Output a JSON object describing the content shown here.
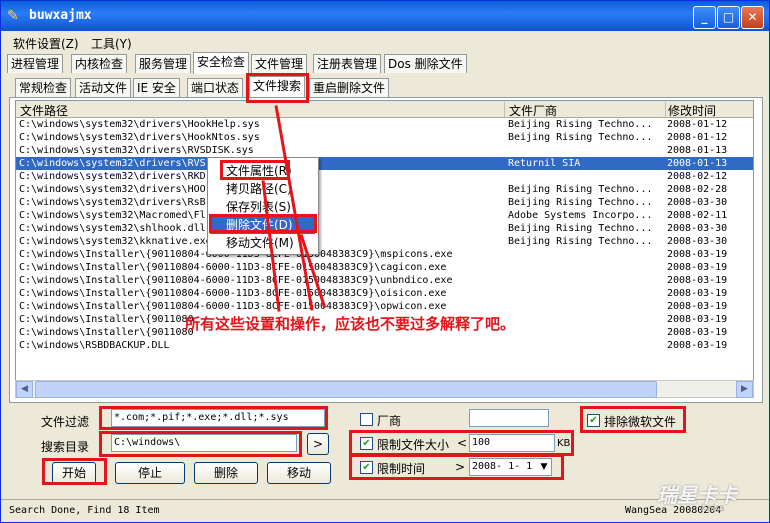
{
  "window": {
    "title": "buwxajmx",
    "min_label": "_",
    "max_label": "□",
    "close_label": "✕"
  },
  "menubar": [
    "软件设置(Z)",
    "工具(Y)"
  ],
  "main_tabs": [
    "进程管理",
    "内核检查",
    "服务管理",
    "安全检查",
    "文件管理",
    "注册表管理",
    "Dos 删除文件"
  ],
  "sub_tabs": [
    "常规检查",
    "活动文件",
    "IE 安全",
    "端口状态",
    "文件搜索",
    "重启删除文件"
  ],
  "table": {
    "headers": [
      "文件路径",
      "文件厂商",
      "修改时间"
    ],
    "rows": [
      {
        "path": "C:\\windows\\system32\\drivers\\HookHelp.sys",
        "vendor": "Beijing Rising Techno...",
        "date": "2008-01-12"
      },
      {
        "path": "C:\\windows\\system32\\drivers\\HookNtos.sys",
        "vendor": "Beijing Rising Techno...",
        "date": "2008-01-12"
      },
      {
        "path": "C:\\windows\\system32\\drivers\\RVSDISK.sys",
        "vendor": "",
        "date": "2008-01-13"
      },
      {
        "path": "C:\\windows\\system32\\drivers\\RVS",
        "vendor": "Returnil SIA",
        "date": "2008-01-13"
      },
      {
        "path": "C:\\windows\\system32\\drivers\\RKD",
        "vendor": "",
        "date": "2008-02-12"
      },
      {
        "path": "C:\\windows\\system32\\drivers\\HOO",
        "vendor": "Beijing Rising Techno...",
        "date": "2008-02-28"
      },
      {
        "path": "C:\\windows\\system32\\drivers\\RsB",
        "vendor": "Beijing Rising Techno...",
        "date": "2008-03-30"
      },
      {
        "path": "C:\\windows\\system32\\Macromed\\Fl                    eX.exe",
        "vendor": "Adobe Systems Incorpo...",
        "date": "2008-02-11"
      },
      {
        "path": "C:\\windows\\system32\\shlhook.dll",
        "vendor": "Beijing Rising Techno...",
        "date": "2008-03-30"
      },
      {
        "path": "C:\\windows\\system32\\kknative.exe",
        "vendor": "Beijing Rising Techno...",
        "date": "2008-03-30"
      },
      {
        "path": "C:\\windows\\Installer\\{90110804-6000-11D3-8CFE-0150048383C9}\\mspicons.exe",
        "vendor": "",
        "date": "2008-03-19"
      },
      {
        "path": "C:\\windows\\Installer\\{90110804-6000-11D3-8CFE-0150048383C9}\\cagicon.exe",
        "vendor": "",
        "date": "2008-03-19"
      },
      {
        "path": "C:\\windows\\Installer\\{90110804-6000-11D3-8CFE-0150048383C9}\\unbndico.exe",
        "vendor": "",
        "date": "2008-03-19"
      },
      {
        "path": "C:\\windows\\Installer\\{90110804-6000-11D3-8CFE-0150048383C9}\\oisicon.exe",
        "vendor": "",
        "date": "2008-03-19"
      },
      {
        "path": "C:\\windows\\Installer\\{90110804-6000-11D3-8CFE-0150048383C9}\\opwicon.exe",
        "vendor": "",
        "date": "2008-03-19"
      },
      {
        "path": "C:\\windows\\Installer\\{9011080",
        "vendor": "",
        "date": "2008-03-19"
      },
      {
        "path": "C:\\windows\\Installer\\{9011080",
        "vendor": "",
        "date": "2008-03-19"
      },
      {
        "path": "C:\\windows\\RSBDBACKUP.DLL",
        "vendor": "",
        "date": "2008-03-19"
      }
    ]
  },
  "context_menu": [
    "文件属性(R)",
    "拷贝路径(C)",
    "保存列表(S)",
    "删除文件(D)",
    "移动文件(M)"
  ],
  "annotation": "所有这些设置和操作，应该也不要过多解释了吧。",
  "form": {
    "filter_label": "文件过滤",
    "filter_value": "*.com;*.pif;*.exe;*.dll;*.sys",
    "dir_label": "搜索目录",
    "dir_value": "C:\\windows\\",
    "browse_label": ">",
    "start_label": "开始",
    "stop_label": "停止",
    "delete_label": "删除",
    "move_label": "移动",
    "vendor_label": "厂商",
    "vendor_value": "",
    "exclude_ms_label": "排除微软文件",
    "size_label": "限制文件大小",
    "size_op": "<",
    "size_value": "100",
    "size_unit": "KB",
    "time_label": "限制时间",
    "time_op": ">",
    "time_value": "2008- 1- 1"
  },
  "status": {
    "left": "Search Done, Find 18 Item",
    "right": "WangSea 20080204"
  },
  "watermark": "瑞星卡卡",
  "watermark_sub": "kaka"
}
